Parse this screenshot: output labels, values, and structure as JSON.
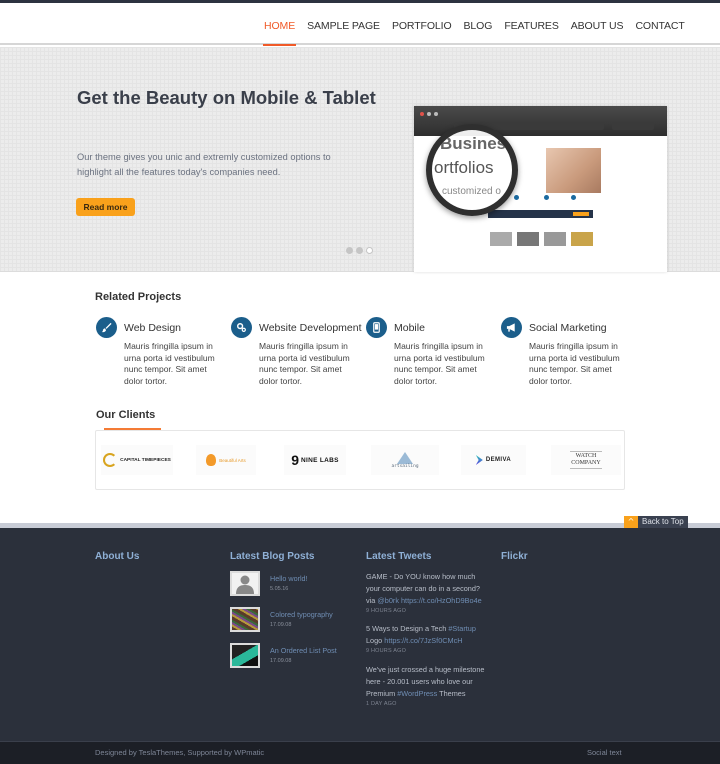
{
  "nav": {
    "items": [
      {
        "label": "HOME",
        "active": true
      },
      {
        "label": "SAMPLE PAGE"
      },
      {
        "label": "PORTFOLIO"
      },
      {
        "label": "BLOG"
      },
      {
        "label": "FEATURES"
      },
      {
        "label": "ABOUT US"
      },
      {
        "label": "CONTACT"
      }
    ]
  },
  "hero": {
    "title": "Get the Beauty on Mobile & Tablet",
    "text": "Our theme gives you unic and extremly customized options to highlight all the features today's companies need.",
    "button_label": "Read more",
    "slides": 3,
    "active_slide": 3,
    "mockup": {
      "lens_line1": "Business",
      "lens_line2": "ortfolios",
      "lens_line3": "customized o"
    }
  },
  "related": {
    "title": "Related Projects",
    "items": [
      {
        "icon": "paintbrush-icon",
        "title": "Web Design",
        "text": "Mauris fringilla ipsum in urna porta id vestibulum nunc tempor. Sit amet dolor tortor."
      },
      {
        "icon": "gears-icon",
        "title": "Website Development",
        "text": "Mauris fringilla ipsum in urna porta id vestibulum nunc tempor. Sit amet dolor tortor."
      },
      {
        "icon": "mobile-icon",
        "title": "Mobile",
        "text": "Mauris fringilla ipsum in urna porta id vestibulum nunc tempor. Sit amet dolor tortor."
      },
      {
        "icon": "megaphone-icon",
        "title": "Social Marketing",
        "text": "Mauris fringilla ipsum in urna porta id vestibulum nunc tempor. Sit amet dolor tortor."
      }
    ]
  },
  "clients": {
    "title": "Our Clients",
    "logos": [
      "CAPITAL TIMEPIECES",
      "Beautiful Arts",
      "NINE LABS",
      "artsailing",
      "DEMIVA",
      "WATCH COMPANY"
    ]
  },
  "back_to_top": "Back to Top",
  "footer": {
    "about_title": "About Us",
    "blog_title": "Latest Blog Posts",
    "tweets_title": "Latest Tweets",
    "flickr_title": "Flickr",
    "posts": [
      {
        "title": "Hello world!",
        "date": "5.05.16"
      },
      {
        "title": "Colored typography",
        "date": "17.09.08"
      },
      {
        "title": "An Ordered List Post",
        "date": "17.09.08"
      }
    ],
    "tweets": [
      {
        "text": "GAME - Do YOU know how much your computer can do in a second? via ",
        "mention": "@b0rk",
        "link": "https://t.co/HzOhD9Bo4e",
        "ago": "9 HOURS AGO"
      },
      {
        "text": "5 Ways to Design a Tech ",
        "hashtag": "#Startup",
        "text2": " Logo ",
        "link": "https://t.co/7JzSf0CMcH",
        "ago": "9 HOURS AGO"
      },
      {
        "text": "We've just crossed a huge milestone here - 20.001 users who love our Premium ",
        "hashtag": "#WordPress",
        "text2": " Themes",
        "ago": "1 DAY AGO"
      }
    ]
  },
  "bottom": {
    "credits": "Designed by TeslaThemes, Supported by WPmatic",
    "social": "Social text"
  }
}
